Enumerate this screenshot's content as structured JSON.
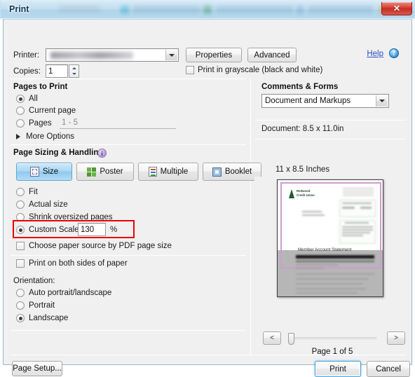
{
  "window": {
    "title": "Print",
    "close_label": "✕"
  },
  "background_tabs": [
    {
      "label": "",
      "color": "#8ab4cc"
    },
    {
      "label": "",
      "color": "#2aa8c8"
    },
    {
      "label": "",
      "color": "#7fa8c0"
    },
    {
      "label": "",
      "color": "#2f8f5f"
    },
    {
      "label": "",
      "color": "#6f95b5"
    },
    {
      "label": "",
      "color": "#c8a23a"
    },
    {
      "label": "",
      "color": "#7e9cb8"
    }
  ],
  "printer": {
    "label": "Printer:",
    "value": "",
    "properties_label": "Properties",
    "advanced_label": "Advanced"
  },
  "copies": {
    "label": "Copies:",
    "value": "1"
  },
  "grayscale": {
    "label": "Print in grayscale (black and white)",
    "checked": false
  },
  "help": {
    "label": "Help",
    "icon_glyph": "?"
  },
  "pages_to_print": {
    "title": "Pages to Print",
    "options": [
      {
        "label": "All",
        "selected": true
      },
      {
        "label": "Current page",
        "selected": false
      },
      {
        "label": "Pages",
        "selected": false
      }
    ],
    "pages_value": "1 - 5",
    "more_options_label": "More Options"
  },
  "page_sizing": {
    "title": "Page Sizing & Handling",
    "info_glyph": "i",
    "buttons": [
      {
        "label": "Size",
        "selected": true
      },
      {
        "label": "Poster",
        "selected": false
      },
      {
        "label": "Multiple",
        "selected": false
      },
      {
        "label": "Booklet",
        "selected": false
      }
    ],
    "scale_options": [
      {
        "label": "Fit",
        "selected": false
      },
      {
        "label": "Actual size",
        "selected": false
      },
      {
        "label": "Shrink oversized pages",
        "selected": false
      },
      {
        "label": "Custom Scale:",
        "selected": true
      }
    ],
    "custom_scale_value": "130",
    "percent_symbol": "%",
    "highlight_color": "#ee0000",
    "paper_source_label": "Choose paper source by PDF page size",
    "paper_source_checked": false,
    "both_sides_label": "Print on both sides of paper",
    "both_sides_checked": false
  },
  "orientation": {
    "title": "Orientation:",
    "options": [
      {
        "label": "Auto portrait/landscape",
        "selected": false
      },
      {
        "label": "Portrait",
        "selected": false
      },
      {
        "label": "Landscape",
        "selected": true
      }
    ]
  },
  "comments_forms": {
    "title": "Comments & Forms",
    "value": "Document and Markups"
  },
  "document_info": {
    "label": "Document: 8.5 x 11.0in"
  },
  "preview": {
    "sheet_size_label": "11 x 8.5 Inches",
    "doc_logo_line1": "Redwood",
    "doc_logo_line2": "Credit Union",
    "doc_heading": "Member Account Statement",
    "prev_label": "<",
    "next_label": ">",
    "page_indicator": "Page 1 of 5"
  },
  "footer": {
    "page_setup_label": "Page Setup...",
    "print_label": "Print",
    "cancel_label": "Cancel"
  }
}
